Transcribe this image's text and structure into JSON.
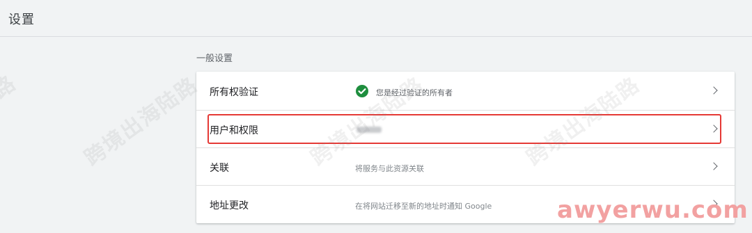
{
  "header": {
    "title": "设置"
  },
  "section": {
    "title": "一般设置"
  },
  "rows": [
    {
      "label": "所有权验证",
      "description": "您是经过验证的所有者",
      "icon": "check-circle-icon"
    },
    {
      "label": "用户和权限",
      "description": ""
    },
    {
      "label": "关联",
      "description": "将服务与此资源关联"
    },
    {
      "label": "地址更改",
      "description": "在将网站迁移至新的地址时通知 Google"
    }
  ],
  "watermark": {
    "text": "跨境出海陆路"
  },
  "brand": {
    "text": "awyerwu.com"
  },
  "colors": {
    "verified": "#1e8e3e",
    "highlight": "#e53935"
  }
}
